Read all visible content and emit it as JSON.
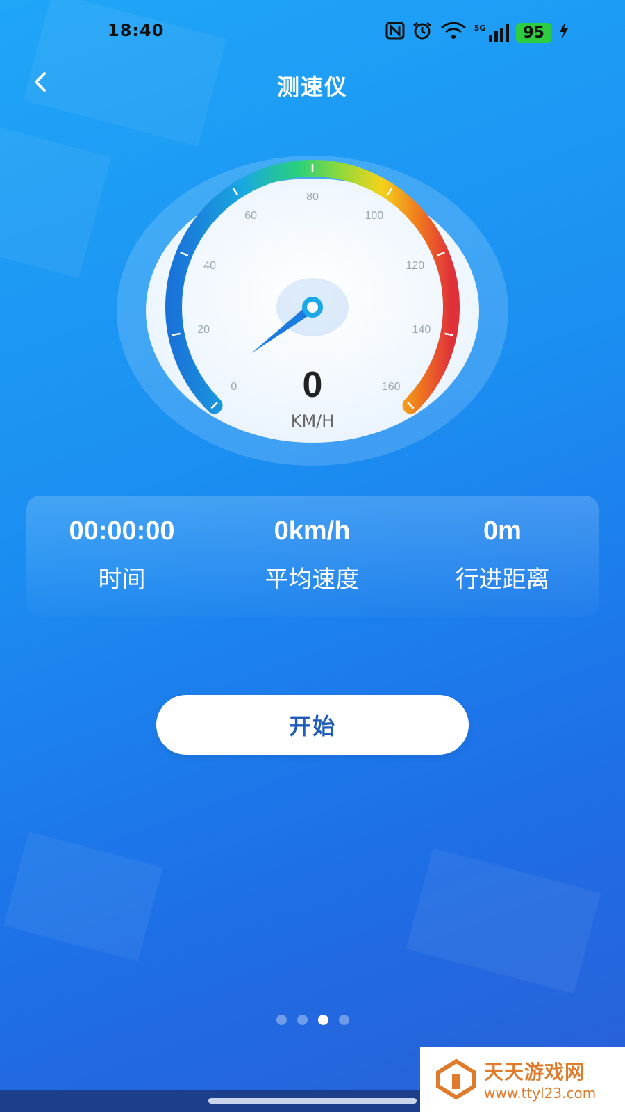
{
  "status_bar": {
    "time": "18:40",
    "network": "5G",
    "battery": "95"
  },
  "header": {
    "title": "测速仪",
    "back_icon": "chevron-left-icon"
  },
  "gauge": {
    "current_speed": "0",
    "unit": "KM/H",
    "tick_labels": [
      "0",
      "20",
      "40",
      "60",
      "80",
      "100",
      "120",
      "140",
      "160"
    ],
    "min": 0,
    "max": 160,
    "needle_value": 0
  },
  "stats": [
    {
      "value": "00:00:00",
      "label": "时间"
    },
    {
      "value": "0km/h",
      "label": "平均速度"
    },
    {
      "value": "0m",
      "label": "行进距离"
    }
  ],
  "start_button": {
    "label": "开始"
  },
  "pager": {
    "count": 4,
    "active_index": 2
  },
  "watermark": {
    "name": "天天游戏网",
    "url": "www.ttyl23.com"
  },
  "colors": {
    "accent": "#1f5db8",
    "background": "#1b8ff2"
  }
}
